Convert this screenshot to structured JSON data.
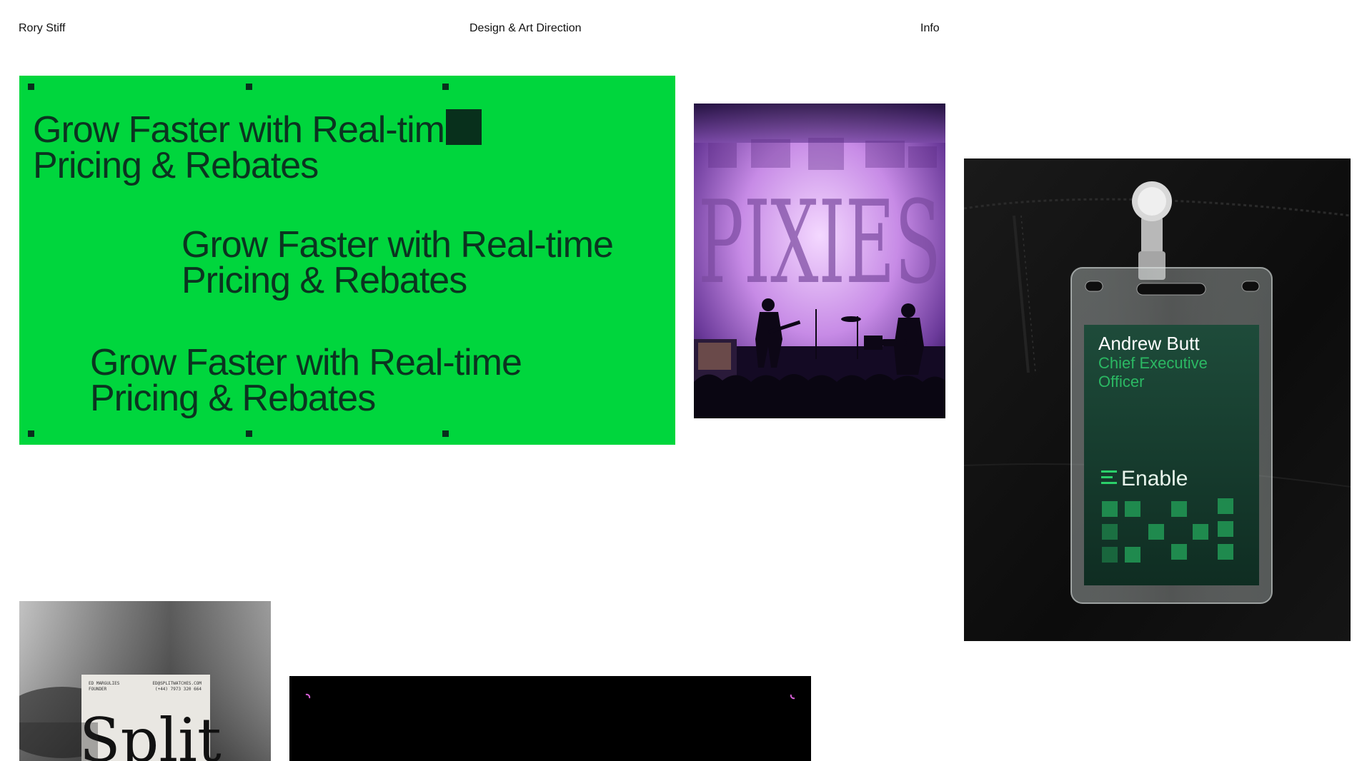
{
  "header": {
    "name": "Rory Stiff",
    "tagline": "Design & Art Direction",
    "info_link": "Info"
  },
  "green_tile": {
    "lines": [
      [
        "Grow Faster with Real-tim",
        "Pricing & Rebates"
      ],
      [
        "Grow Faster with Real-time",
        "Pricing & Rebates"
      ],
      [
        "Grow Faster with Real-time",
        "Pricing & Rebates"
      ]
    ]
  },
  "concert_photo": {
    "backdrop_text": "PIXIES"
  },
  "badge_photo": {
    "person_name": "Andrew Butt",
    "person_title_line1": "Chief Executive",
    "person_title_line2": "Officer",
    "brand": "Enable"
  },
  "card_photo": {
    "left_line1": "ED MARGULIES",
    "left_line2": "FOUNDER",
    "right_line1": "ED@SPLITWATCHES.COM",
    "right_line2": "(+44) 7973 320 664",
    "wordmark": "Split"
  },
  "colors": {
    "green": "#00d63d",
    "dark_green": "#0b3420",
    "badge_green": "#1f8a4e"
  }
}
